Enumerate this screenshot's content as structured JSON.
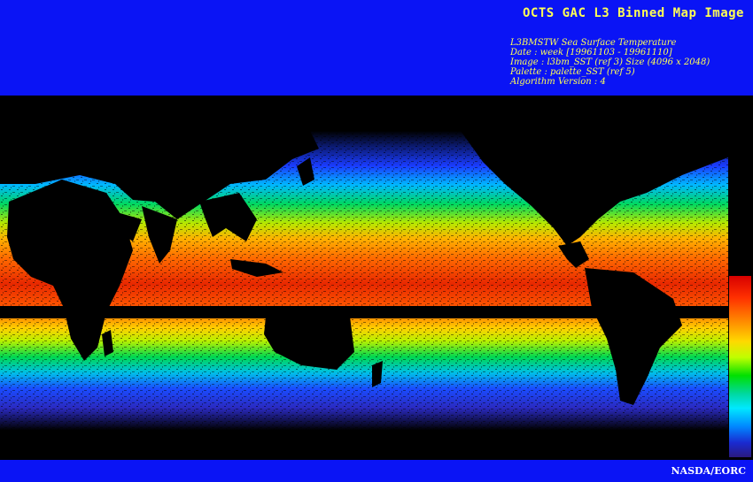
{
  "header": {
    "title": "OCTS GAC L3 Binned Map Image",
    "meta_lines": [
      "L3BMSTW Sea Surface Temperature",
      "Date : week [19961103 - 19961110]",
      "Image : l3bm_SST (ref 3) Size (4096 x 2048)",
      "Palette : palette_SST (ref 5)",
      "Algorithm Version : 4"
    ]
  },
  "footer": {
    "credit": "NASDA/EORC"
  },
  "colors": {
    "banner": "#0a14f5",
    "title_text": "#ffff55",
    "credit_text": "#ffffff",
    "background": "#000000"
  },
  "colorbar": {
    "stops": [
      "#d80000",
      "#ff3000",
      "#ff8a00",
      "#ffd800",
      "#bfff00",
      "#00e000",
      "#00d8a0",
      "#00e8ff",
      "#0088ff",
      "#1a2ad0",
      "#2a1a80"
    ],
    "orientation": "vertical",
    "label": ""
  }
}
